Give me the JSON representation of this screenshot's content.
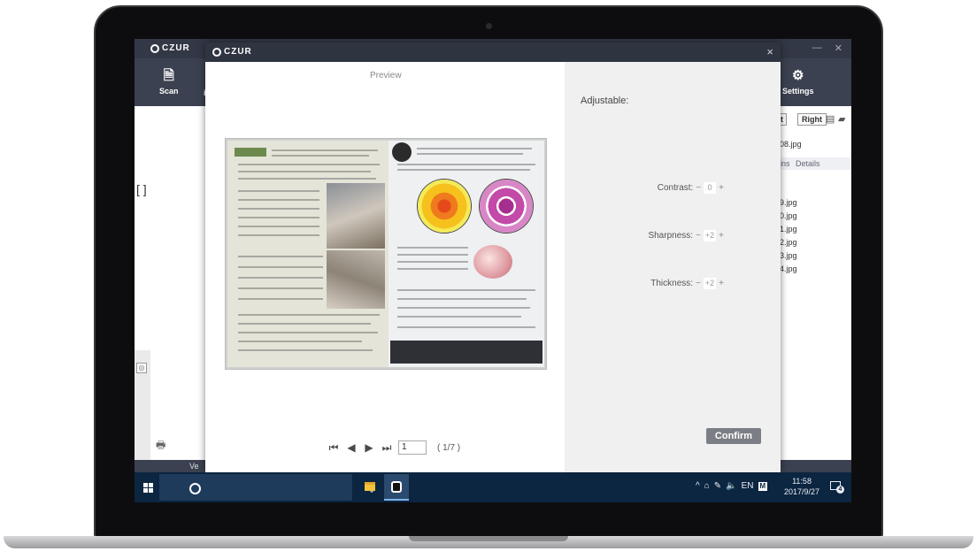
{
  "background_app": {
    "brand": "CZUR",
    "toolbar": {
      "scan_label": "Scan",
      "settings_label": "Settings",
      "partial_label": "i"
    },
    "right_panel": {
      "buttons": [
        "t",
        "Right"
      ],
      "top_file": "08.jpg",
      "header_left": "ins",
      "header_right": "Details",
      "files": [
        "9.jpg",
        "0.jpg",
        "1.jpg",
        "2.jpg",
        "3.jpg",
        "4.jpg"
      ]
    },
    "bottom_text": "Ve"
  },
  "preview_dialog": {
    "brand": "CZUR",
    "close_glyph": "×",
    "preview_label": "Preview",
    "navigation": {
      "page_value": "1",
      "page_count": "( 1/7 )"
    },
    "adjust_panel": {
      "title": "Adjustable:",
      "controls": [
        {
          "label": "Contrast:",
          "value": "0"
        },
        {
          "label": "Sharpness:",
          "value": "+2"
        },
        {
          "label": "Thickness:",
          "value": "+2"
        }
      ],
      "minus": "−",
      "plus": "+",
      "confirm_label": "Confirm"
    }
  },
  "taskbar": {
    "tray": {
      "language": "EN",
      "ime": "M"
    },
    "clock": {
      "time": "11:58",
      "date": "2017/9/27"
    },
    "notification_count": "4"
  }
}
